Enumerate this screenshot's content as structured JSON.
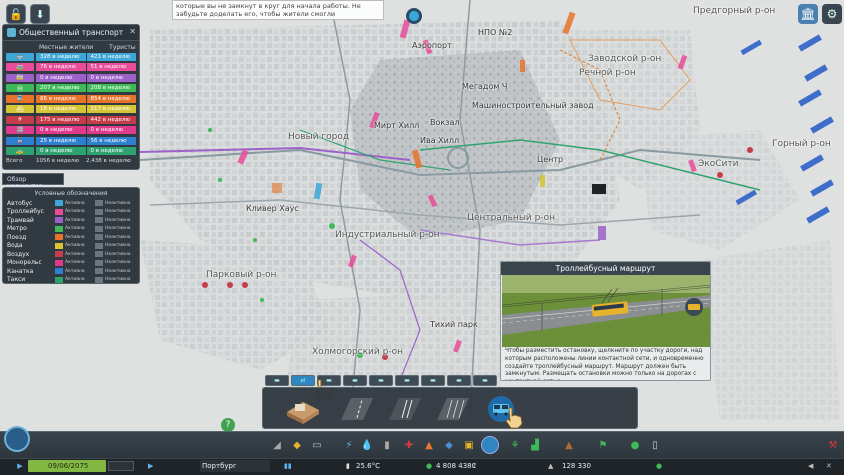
{
  "tooltip_top": "которые вы не замкнут в круг для начала работы. Не забудьте доделать его, чтобы жители смогли перемещаться по городу!",
  "map_labels": [
    {
      "text": "Аэропорт",
      "cls": "district"
    },
    {
      "text": "НПО №2",
      "cls": ""
    },
    {
      "text": "Мегадом Ч",
      "cls": ""
    },
    {
      "text": "Машиностроительный завод",
      "cls": ""
    },
    {
      "text": "Вокзал",
      "cls": ""
    },
    {
      "text": "Мирт Хилл",
      "cls": ""
    },
    {
      "text": "Ива Хилл",
      "cls": ""
    },
    {
      "text": "Новый город",
      "cls": "district"
    },
    {
      "text": "Центр",
      "cls": ""
    },
    {
      "text": "Кливер Хаус",
      "cls": ""
    },
    {
      "text": "Индустриальный р-он",
      "cls": "district"
    },
    {
      "text": "Центральный р-он",
      "cls": "district"
    },
    {
      "text": "Парковый р-он",
      "cls": "district"
    },
    {
      "text": "Холмогорский р-он",
      "cls": "district"
    },
    {
      "text": "Тихий парк",
      "cls": ""
    },
    {
      "text": "Заводской р-он",
      "cls": "district"
    },
    {
      "text": "Речной р-он",
      "cls": "district"
    },
    {
      "text": "Предгорный р-он",
      "cls": "district"
    },
    {
      "text": "ЭкоСити",
      "cls": "district"
    },
    {
      "text": "Горный р-он",
      "cls": "district"
    }
  ],
  "transport_panel": {
    "title": "Общественный транспорт",
    "col_residents": "Местные жители",
    "col_tourists": "Туристы",
    "rows": [
      {
        "color": "#3ea7d6",
        "residents": "328 в неделю",
        "tourists": "421 в неделю",
        "icon": "bus-icon",
        "glyph": "🚌"
      },
      {
        "color": "#e84c9a",
        "residents": "76 в неделю",
        "tourists": "51 в неделю",
        "icon": "trolleybus-icon",
        "glyph": "🚎"
      },
      {
        "color": "#9c62c9",
        "residents": "0 в неделю",
        "tourists": "0 в неделю",
        "icon": "tram-icon",
        "glyph": "🚋"
      },
      {
        "color": "#3fba59",
        "residents": "207 в неделю",
        "tourists": "208 в неделю",
        "icon": "metro-icon",
        "glyph": "Ⓜ"
      },
      {
        "color": "#e8742c",
        "residents": "86 в неделю",
        "tourists": "854 в неделю",
        "icon": "train-icon",
        "glyph": "🚆"
      },
      {
        "color": "#d6c534",
        "residents": "18 в неделю",
        "tourists": "217 в неделю",
        "icon": "ship-icon",
        "glyph": "⛴"
      },
      {
        "color": "#c63c4a",
        "residents": "175 в неделю",
        "tourists": "442 в неделю",
        "icon": "plane-icon",
        "glyph": "✈"
      },
      {
        "color": "#e03a8c",
        "residents": "0 в неделю",
        "tourists": "0 в неделю",
        "icon": "monorail-icon",
        "glyph": "🚝"
      },
      {
        "color": "#2d7fd0",
        "residents": "25 в неделю",
        "tourists": "56 в неделю",
        "icon": "cablecar-icon",
        "glyph": "🚡"
      },
      {
        "color": "#2fa36f",
        "residents": "0 в неделю",
        "tourists": "0 в неделю",
        "icon": "taxi-icon",
        "glyph": "🚕"
      }
    ],
    "total_label": "Всего",
    "total_residents": "1056 в неделю",
    "total_tourists": "2,438 в неделю"
  },
  "routes_button": "Обзор маршрутов",
  "legend_panel": {
    "title": "Условные обозначения",
    "rows": [
      {
        "name": "Автобус",
        "active": "Активна",
        "inactive": "Неактивна",
        "color": "#3ea7d6"
      },
      {
        "name": "Троллейбус",
        "active": "Активна",
        "inactive": "Неактивна",
        "color": "#e84c9a"
      },
      {
        "name": "Трамвай",
        "active": "Активна",
        "inactive": "Неактивна",
        "color": "#9c62c9"
      },
      {
        "name": "Метро",
        "active": "Активна",
        "inactive": "Неактивна",
        "color": "#3fba59"
      },
      {
        "name": "Поезд",
        "active": "Активна",
        "inactive": "Неактивна",
        "color": "#e8742c"
      },
      {
        "name": "Вода",
        "active": "Активна",
        "inactive": "Неактивна",
        "color": "#d6c534"
      },
      {
        "name": "Воздух",
        "active": "Активна",
        "inactive": "Неактивна",
        "color": "#c63c4a"
      },
      {
        "name": "Монорельс",
        "active": "Активна",
        "inactive": "Неактивна",
        "color": "#e03a8c"
      },
      {
        "name": "Канатка",
        "active": "Активна",
        "inactive": "Неактивна",
        "color": "#2d7fd0"
      },
      {
        "name": "Такси",
        "active": "Активна",
        "inactive": "Неактивна",
        "color": "#2fa36f"
      }
    ]
  },
  "trolley_panel": {
    "title": "Троллейбусный маршрут",
    "description": "Чтобы разместить остановку, щелкните по участку дороги, над которым расположены линии контактной сети, и одновременно создайте троллейбусный маршрут. Маршрут должен быть замкнутым. Размещать остановки можно только на дорогах с контактной сетью."
  },
  "bottom_bar": {
    "date": "09/06/2075",
    "city": "Портбург",
    "temperature": "25.6°C",
    "money": "4 808 438₢",
    "population": "128 330"
  },
  "colors": {
    "accent": "#2f86c0",
    "date_bg": "#83b943"
  }
}
